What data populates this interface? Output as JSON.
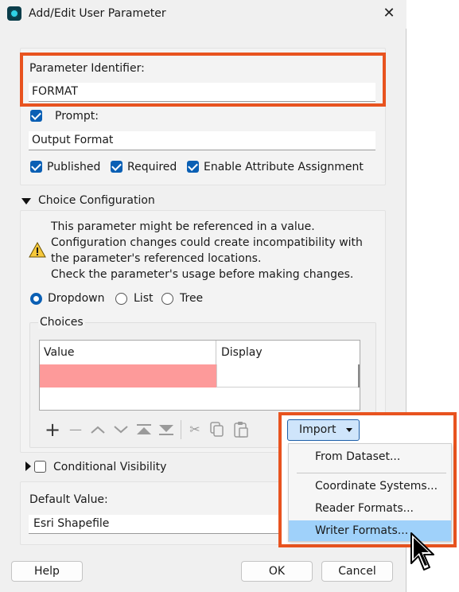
{
  "window": {
    "title": "Add/Edit User Parameter",
    "close_symbol": "✕"
  },
  "identifier": {
    "label": "Parameter Identifier:",
    "value": "FORMAT"
  },
  "prompt": {
    "label": "Prompt:",
    "checked": true,
    "value": "Output Format"
  },
  "flags": {
    "published": "Published",
    "required": "Required",
    "enable_attr": "Enable Attribute Assignment"
  },
  "choice_config": {
    "heading": "Choice Configuration",
    "warning_lines": [
      "This parameter might be referenced in a value.",
      "Configuration changes could create incompatibility with",
      "the parameter's referenced locations.",
      "Check the parameter's usage before making changes."
    ],
    "modes": [
      "Dropdown",
      "List",
      "Tree"
    ],
    "selected_mode": "Dropdown",
    "choices_label": "Choices",
    "columns": [
      "Value",
      "Display"
    ],
    "row_highlight_color": "#fd9a9a"
  },
  "toolbar": {
    "icons": [
      "add-icon",
      "remove-icon",
      "move-up-icon",
      "move-down-icon",
      "move-top-icon",
      "move-bottom-icon",
      "cut-icon",
      "copy-icon",
      "paste-icon"
    ],
    "symbols": {
      "add": "+",
      "remove": "—",
      "up": "︿",
      "down": "﹀",
      "top": "⏶",
      "bottom": "⏷",
      "cut": "✂",
      "copy": "⧉",
      "paste": "📋"
    }
  },
  "import": {
    "button_label": "Import",
    "menu_items": [
      "From Dataset...",
      "Coordinate Systems...",
      "Reader Formats...",
      "Writer Formats..."
    ],
    "selected_item": "Writer Formats..."
  },
  "conditional_visibility": {
    "label": "Conditional Visibility"
  },
  "default_value": {
    "label": "Default Value:",
    "value": "Esri Shapefile"
  },
  "buttons": {
    "help": "Help",
    "ok": "OK",
    "cancel": "Cancel"
  },
  "colors": {
    "accent": "#0a5fb4",
    "callout": "#e8531f",
    "menu_highlight": "#9fd1fa"
  }
}
